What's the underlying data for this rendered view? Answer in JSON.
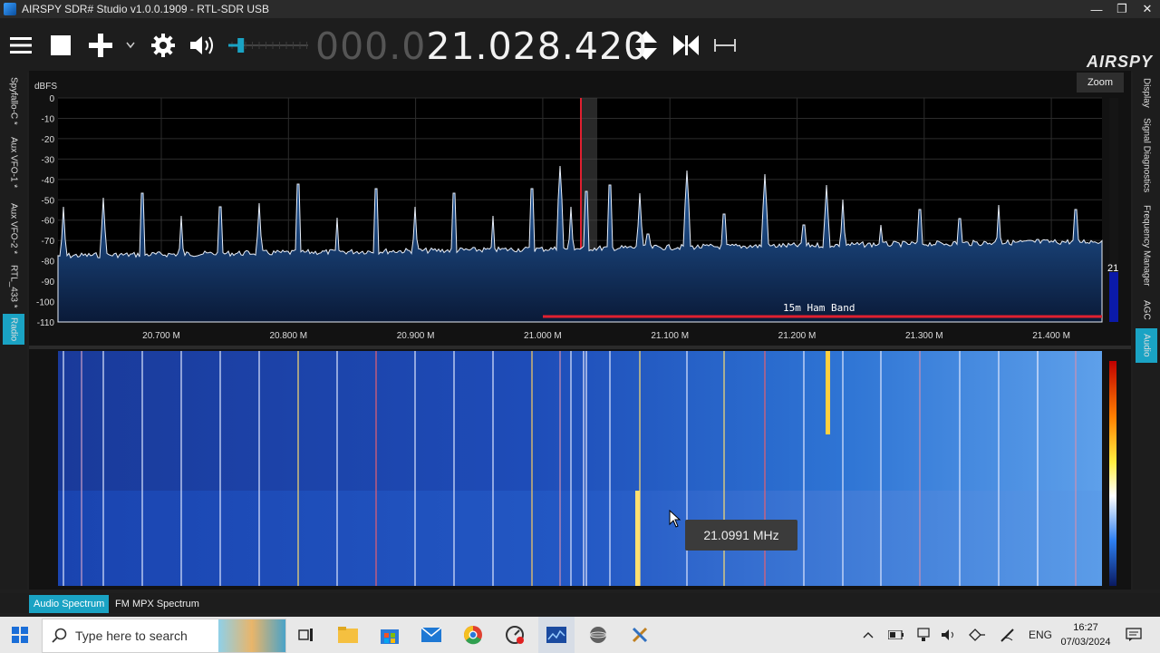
{
  "window": {
    "title": "AIRSPY SDR# Studio v1.0.0.1909 - RTL-SDR USB"
  },
  "toolbar": {
    "frequency_dim": "000.0",
    "frequency_lit": "21.028.420",
    "logo": "AIRSPY",
    "volume_level": 0.15
  },
  "left_tabs": [
    {
      "label": "Spyfallo-C *"
    },
    {
      "label": "Aux VFO-1 *"
    },
    {
      "label": "Aux VFO-2 *"
    },
    {
      "label": "RTL_433 *"
    },
    {
      "label": "Radio"
    }
  ],
  "right_tabs": [
    {
      "label": "Display"
    },
    {
      "label": "Signal Diagnostics"
    },
    {
      "label": "Frequency Manager"
    },
    {
      "label": "AGC"
    },
    {
      "label": "Audio"
    }
  ],
  "spectrum": {
    "y_unit": "dBFS",
    "y_ticks": [
      "0",
      "-10",
      "-20",
      "-30",
      "-40",
      "-50",
      "-60",
      "-70",
      "-80",
      "-90",
      "-100",
      "-110"
    ],
    "x_ticks": [
      "20.700 M",
      "20.800 M",
      "20.900 M",
      "21.000 M",
      "21.100 M",
      "21.200 M",
      "21.300 M",
      "21.400 M"
    ],
    "band_label": "15m Ham Band",
    "zoom_label": "Zoom",
    "level_value": "21"
  },
  "waterfall": {
    "tooltip": "21.0991 MHz"
  },
  "bottom_tabs": [
    {
      "label": "Audio Spectrum"
    },
    {
      "label": "FM MPX Spectrum"
    }
  ],
  "taskbar": {
    "search_placeholder": "Type here to search",
    "language": "ENG",
    "time": "16:27",
    "date": "07/03/2024"
  },
  "colors": {
    "accent": "#1aa3c4",
    "band_marker": "#e02030",
    "spectrum_fill": "#1a4d8c"
  }
}
